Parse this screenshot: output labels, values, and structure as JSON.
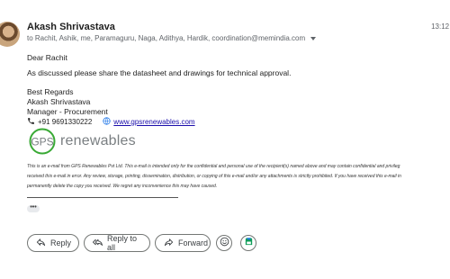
{
  "email": {
    "sender_name": "Akash Shrivastava",
    "recipients": "to Rachit, Ashik, me, Paramaguru, Naga, Adithya, Hardik, coordination@memindia.com",
    "time": "13:12 (",
    "greeting": "Dear Rachit",
    "message": "As discussed please share the datasheet and drawings for technical approval.",
    "signature": {
      "regards": "Best Regards",
      "name": "Akash Shrivastava",
      "title": "Manager - Procurement",
      "phone": "+91 9691330222",
      "website": "www.gpsrenewables.com",
      "logo_mark": "GPS",
      "logo_text": "renewables"
    },
    "disclaimer": [
      "This is an e-mail from GPS Renewables Pvt Ltd. This e-mail is intended only for the confidential and personal use of the recipient(s) named above and may contain confidential and privileg",
      "received this e-mail in error. Any review, storage, printing, dissemination, distribution, or copying of this e-mail and/or any attachments is strictly prohibited. If you have received this e-mail in",
      "permanently delete the copy you received. We regret any inconvenience this may have caused."
    ],
    "ellipsis": "•••"
  },
  "actions": {
    "reply": "Reply",
    "reply_all": "Reply to all",
    "forward": "Forward"
  },
  "colors": {
    "link": "#1a0dab",
    "logo_green": "#39a935",
    "drive_green": "#0f9d58"
  }
}
